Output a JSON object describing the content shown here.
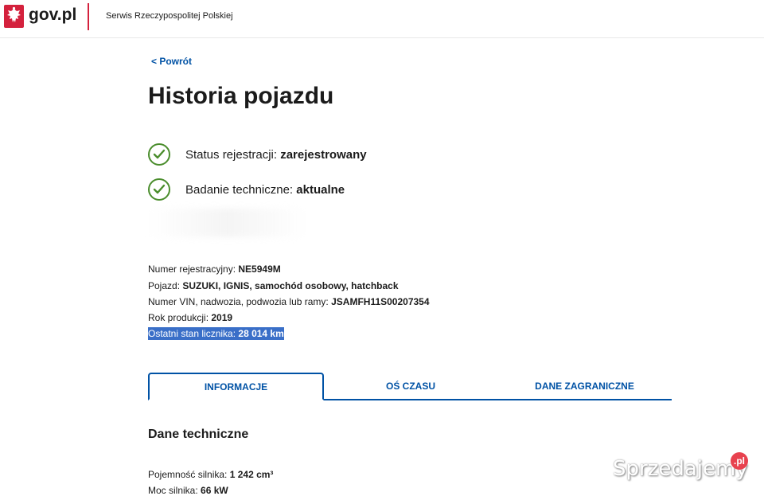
{
  "header": {
    "brand": "gov.pl",
    "service": "Serwis Rzeczypospolitej Polskiej",
    "logo_icon": "polish-eagle-icon",
    "accent": "#d4213d"
  },
  "back_link": "< Powrót",
  "page_title": "Historia pojazdu",
  "status": [
    {
      "label": "Status rejestracji: ",
      "value": "zarejestrowany",
      "icon": "check-circle-icon"
    },
    {
      "label": "Badanie techniczne: ",
      "value": "aktualne",
      "icon": "check-circle-icon"
    }
  ],
  "vehicle": {
    "registration_label": "Numer rejestracyjny: ",
    "registration_value": "NE5949M",
    "vehicle_label": "Pojazd: ",
    "vehicle_value": "SUZUKI, IGNIS, samochód osobowy, hatchback",
    "vin_label": "Numer VIN, nadwozia, podwozia lub ramy: ",
    "vin_value": "JSAMFH11S00207354",
    "year_label": "Rok produkcji: ",
    "year_value": "2019",
    "odometer_label": "Ostatni stan licznika: ",
    "odometer_value": "28 014 km"
  },
  "tabs": [
    {
      "label": "INFORMACJE",
      "active": true
    },
    {
      "label": "OŚ CZASU",
      "active": false
    },
    {
      "label": "DANE ZAGRANICZNE",
      "active": false
    }
  ],
  "section_title": "Dane techniczne",
  "technical": {
    "engine_label": "Pojemność silnika: ",
    "engine_value": "1 242 cm³",
    "power_label": "Moc silnika: ",
    "power_value": "66 kW"
  },
  "watermark": {
    "text": "Sprzedajemy",
    "badge": ".pl"
  },
  "colors": {
    "link": "#0052a5",
    "success": "#4a8d2c",
    "selection": "#3a6fc8"
  }
}
